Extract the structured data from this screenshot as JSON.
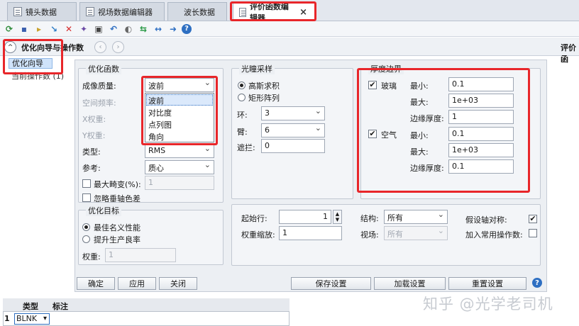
{
  "tabs": [
    {
      "label": "镜头数据"
    },
    {
      "label": "视场数据编辑器"
    },
    {
      "label": "波长数据"
    },
    {
      "label": "评价函数编辑器",
      "close": "×"
    }
  ],
  "toolbar_icons": [
    "refresh-icon",
    "save-icon",
    "load-icon",
    "insert-icon",
    "delete-icon",
    "wizard-icon",
    "clear-icon",
    "undo-icon",
    "toggle-icon",
    "convert-icon",
    "expand-icon",
    "arrow-right-icon",
    "help-icon"
  ],
  "header": {
    "collapse_glyph": "^",
    "title": "优化向导与操作数",
    "prev_glyph": "‹",
    "next_glyph": "›",
    "right_title": "评价函"
  },
  "tree": {
    "items": [
      "优化向导",
      "当前操作数 (1)"
    ]
  },
  "opt_function": {
    "title": "优化函数",
    "image_quality_label": "成像质量:",
    "image_quality_value": "波前",
    "spatial_freq_label": "空间频率:",
    "x_weight_label": "X权重:",
    "y_weight_label": "Y权重:",
    "type_label": "类型:",
    "type_value": "RMS",
    "reference_label": "参考:",
    "reference_value": "质心",
    "max_distortion_label": "最大畸变(%):",
    "max_distortion_value": "1",
    "ignore_lateral_color_label": "忽略垂轴色差",
    "dropdown_options": [
      "波前",
      "对比度",
      "点列图",
      "角向"
    ]
  },
  "pupil": {
    "title": "光瞳采样",
    "gauss_label": "高斯求积",
    "rect_label": "矩形阵列",
    "rings_label": "环:",
    "rings_value": "3",
    "arms_label": "臂:",
    "arms_value": "6",
    "obscuration_label": "遮拦:",
    "obscuration_value": "0"
  },
  "thickness": {
    "title": "厚度边界",
    "glass_label": "玻璃",
    "air_label": "空气",
    "min_label": "最小:",
    "max_label": "最大:",
    "edge_label": "边缘厚度:",
    "glass_min": "0.1",
    "glass_max": "1e+03",
    "glass_edge": "1",
    "air_min": "0.1",
    "air_max": "1e+03",
    "air_edge": "0.1",
    "glass_checked": "✔",
    "air_checked": "✔"
  },
  "target": {
    "title": "优化目标",
    "best_nominal_label": "最佳名义性能",
    "improve_yield_label": "提升生产良率",
    "weight_label": "权重:",
    "weight_value": "1"
  },
  "misc": {
    "start_row_label": "起始行:",
    "start_row_value": "1",
    "weight_scale_label": "权重缩放:",
    "weight_scale_value": "1",
    "structure_label": "结构:",
    "structure_value": "所有",
    "field_label": "视场:",
    "field_value": "所有",
    "assume_symmetry_label": "假设轴对称:",
    "add_common_label": "加入常用操作数:",
    "assume_symmetry_checked": "✔"
  },
  "buttons": {
    "ok": "确定",
    "apply": "应用",
    "close": "关闭",
    "save_settings": "保存设置",
    "load_settings": "加载设置",
    "reset_settings": "重置设置",
    "help": "?"
  },
  "grid": {
    "headers": [
      "类型",
      "标注"
    ],
    "row_number": "1",
    "row_type": "BLNK"
  },
  "watermark": "知乎 @光学老司机",
  "colors": {
    "highlight_red": "#e8262a",
    "selection_blue": "#cfe3fa"
  }
}
